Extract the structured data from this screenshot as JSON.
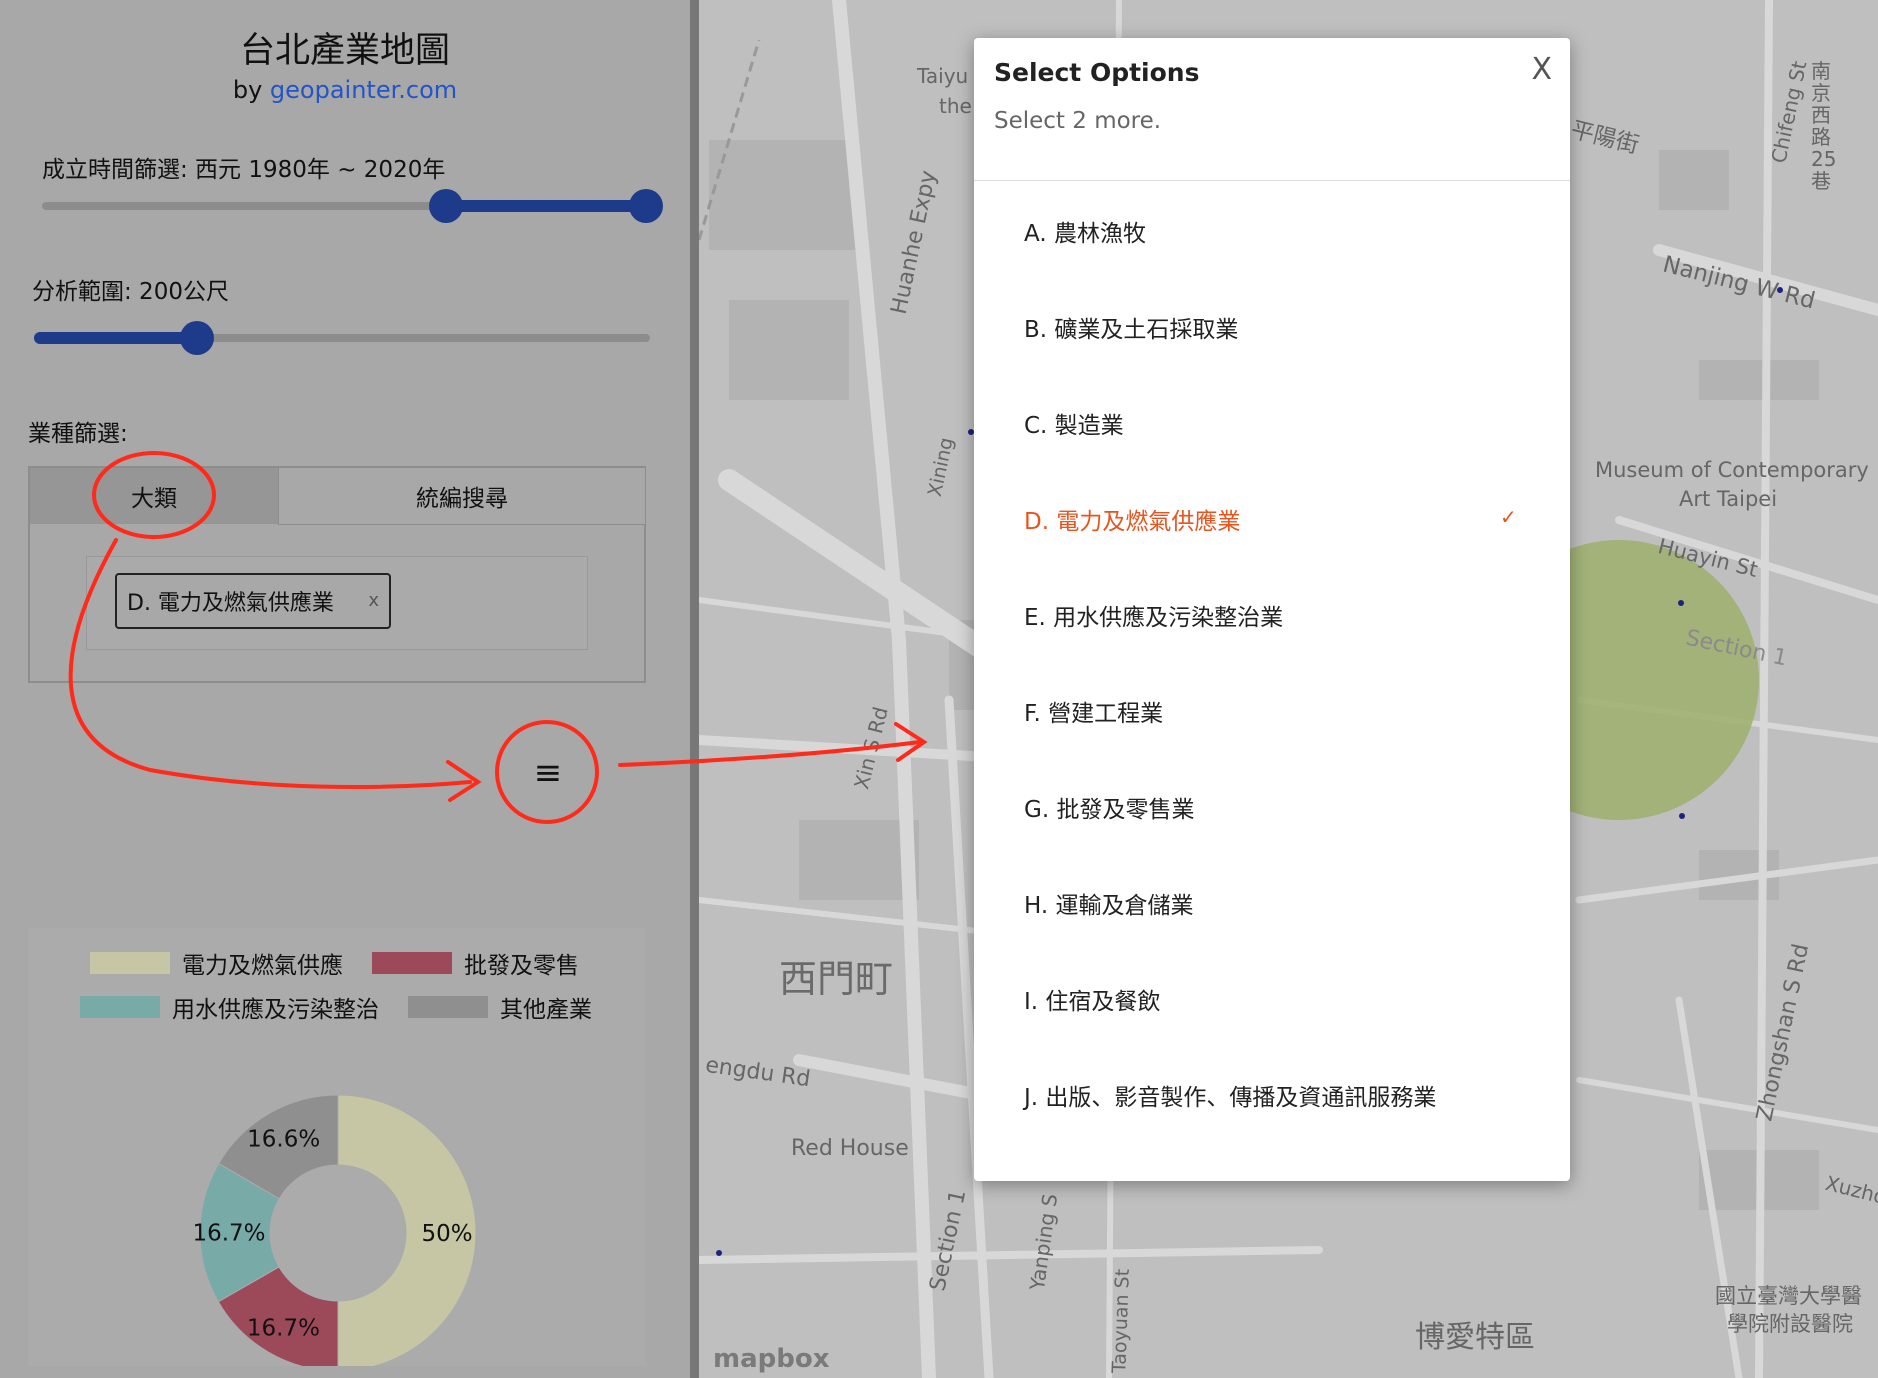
{
  "app": {
    "title": "台北產業地圖",
    "by_prefix": "by ",
    "by_link": "geopainter.com"
  },
  "filters": {
    "year_label": "成立時間篩選: 西元 1980年 ~ 2020年",
    "year_range": [
      1980,
      2020
    ],
    "range_label": "分析範圍: 200公尺",
    "range_value": 200,
    "industry_label": "業種篩選:"
  },
  "tabs": [
    {
      "label": "大類"
    },
    {
      "label": "統編搜尋"
    }
  ],
  "selected_chip": {
    "label": "D. 電力及燃氣供應業",
    "remove": "x"
  },
  "menu_button": {
    "icon": "menu-icon",
    "glyph": "≡"
  },
  "chart_data": {
    "type": "pie",
    "categories": [
      "電力及燃氣供應",
      "批發及零售",
      "用水供應及污染整治",
      "其他產業"
    ],
    "values": [
      50,
      16.7,
      16.7,
      16.6
    ],
    "labels": [
      "50%",
      "16.7%",
      "16.7%",
      "16.6%"
    ],
    "colors": [
      "#c6c6a4",
      "#9c4a5a",
      "#78aaa8",
      "#8f8f8f"
    ],
    "donut": true,
    "legend_position": "top"
  },
  "map": {
    "labels": [
      "西門町",
      "Red House",
      "博愛特區",
      "Museum of Contemporary",
      "Art Taipei",
      "Huayin St",
      "Section 1",
      "Nanjing W Rd",
      "Huanhe Expy",
      "Zhongshan S Rd",
      "Chifeng St",
      "Taoyuan St",
      "Section 1",
      "Yanping S",
      "Xin S Rd",
      "Xining",
      "engdu Rd",
      "平陽街",
      "南京西路25巷",
      "國立臺灣大學醫",
      "學院附設醫院",
      "Taiyu",
      "the",
      "Xuzho",
      "mapbox"
    ]
  },
  "modal": {
    "title": "Select Options",
    "subtitle": "Select 2 more.",
    "close": "X",
    "options": [
      {
        "label": "A. 農林漁牧",
        "selected": false
      },
      {
        "label": "B. 礦業及土石採取業",
        "selected": false
      },
      {
        "label": "C. 製造業",
        "selected": false
      },
      {
        "label": "D. 電力及燃氣供應業",
        "selected": true
      },
      {
        "label": "E. 用水供應及污染整治業",
        "selected": false
      },
      {
        "label": "F. 營建工程業",
        "selected": false
      },
      {
        "label": "G. 批發及零售業",
        "selected": false
      },
      {
        "label": "H. 運輸及倉儲業",
        "selected": false
      },
      {
        "label": "I. 住宿及餐飲",
        "selected": false
      },
      {
        "label": "J. 出版、影音製作、傳播及資通訊服務業",
        "selected": false
      }
    ],
    "check_glyph": "✓"
  },
  "colors": {
    "accent": "#e8541d",
    "slider": "#1e3a8a",
    "link": "#2255c8",
    "annotation": "#ff2a1a"
  }
}
